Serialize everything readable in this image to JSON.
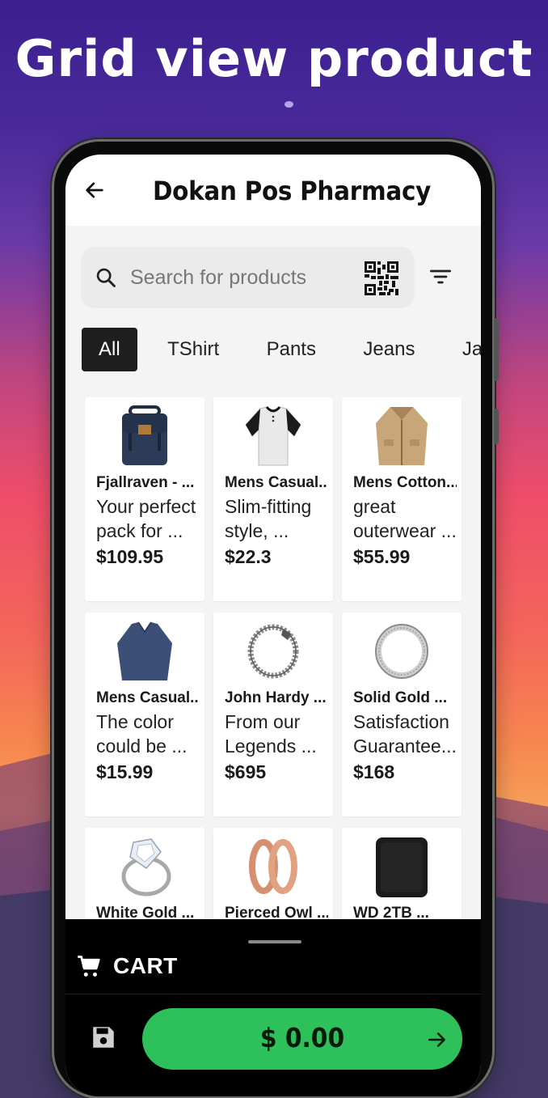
{
  "promo": {
    "headline": "Grid view product"
  },
  "app": {
    "title": "Dokan Pos Pharmacy",
    "search": {
      "placeholder": "Search for products"
    },
    "categories": [
      "All",
      "TShirt",
      "Pants",
      "Jeans",
      "Jacke"
    ],
    "active_category": "All",
    "products": [
      {
        "name": "Fjallraven - ...",
        "desc": "Your perfect pack for ...",
        "price": "$109.95",
        "icon": "backpack-image"
      },
      {
        "name": "Mens Casual...",
        "desc": "Slim-fitting style, ...",
        "price": "$22.3",
        "icon": "tshirt-image"
      },
      {
        "name": "Mens Cotton...",
        "desc": "great outerwear ...",
        "price": "$55.99",
        "icon": "jacket-image"
      },
      {
        "name": "Mens Casual...",
        "desc": "The color could be ...",
        "price": "$15.99",
        "icon": "sweater-image"
      },
      {
        "name": "John Hardy ...",
        "desc": "From our Legends ...",
        "price": "$695",
        "icon": "bracelet-image"
      },
      {
        "name": "Solid Gold ...",
        "desc": "Satisfaction Guarantee...",
        "price": "$168",
        "icon": "ring-image"
      },
      {
        "name": "White Gold ...",
        "desc": "",
        "price": "",
        "icon": "diamond-ring-image"
      },
      {
        "name": "Pierced Owl ...",
        "desc": "",
        "price": "",
        "icon": "rose-gold-earrings-image"
      },
      {
        "name": "WD 2TB ...",
        "desc": "",
        "price": "",
        "icon": "hard-drive-image"
      }
    ],
    "cart": {
      "label": "CART",
      "total": "$ 0.00"
    },
    "colors": {
      "accent_green": "#2ec05b",
      "chip_active": "#1e1e1e",
      "cart_bar": "#000000"
    }
  }
}
